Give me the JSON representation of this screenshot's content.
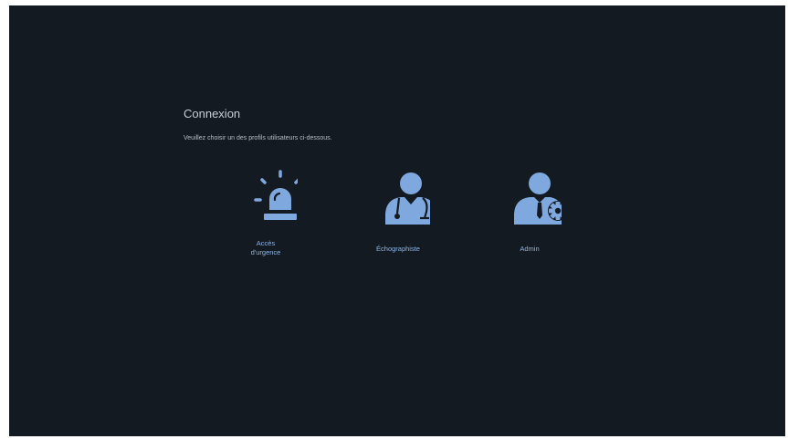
{
  "colors": {
    "background": "#141a21",
    "accent": "#7fa8de",
    "title": "#c9ced6",
    "text": "#b7bdc6",
    "label": "#8fb4e3"
  },
  "login": {
    "title": "Connexion",
    "instruction": "Veuillez choisir un des profils utilisateurs ci-dessous."
  },
  "profiles": [
    {
      "icon": "emergency-siren-icon",
      "label": "Accès\nd'urgence"
    },
    {
      "icon": "doctor-stethoscope-icon",
      "label": "Échographiste"
    },
    {
      "icon": "admin-user-gear-icon",
      "label": "Admin"
    }
  ]
}
